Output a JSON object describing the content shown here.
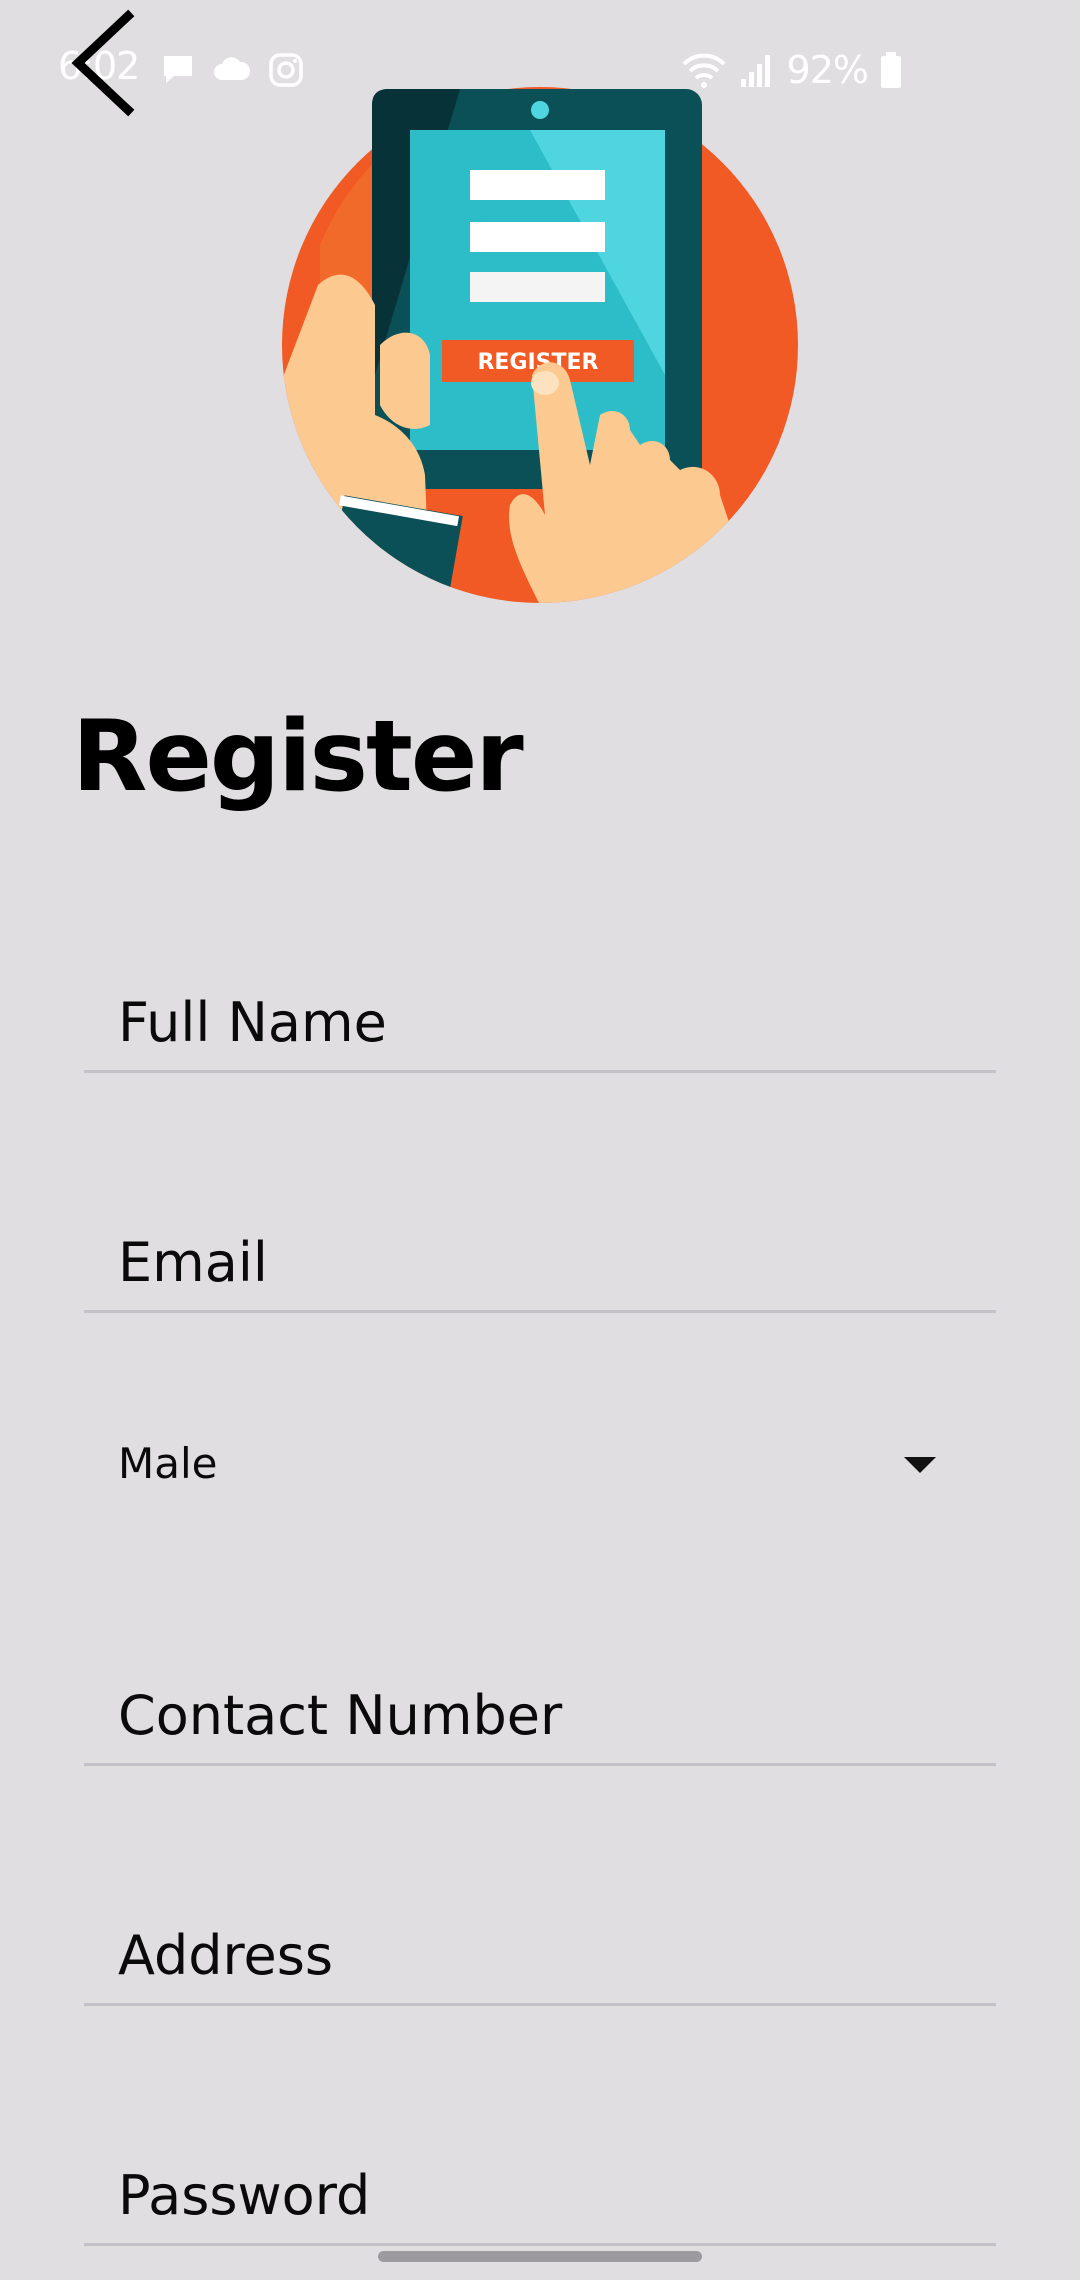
{
  "status_bar": {
    "time": "6:02",
    "battery": "92%",
    "icons_left": [
      "message-icon",
      "cloud-icon",
      "instagram-icon"
    ],
    "icons_right": [
      "wifi-icon",
      "signal-icon",
      "battery-icon"
    ]
  },
  "illustration": {
    "button_text": "REGISTER"
  },
  "page": {
    "title": "Register"
  },
  "form": {
    "full_name_placeholder": "Full Name",
    "email_placeholder": "Email",
    "gender_selected": "Male",
    "contact_placeholder": "Contact Number",
    "address_placeholder": "Address",
    "password_placeholder": "Password"
  },
  "colors": {
    "background": "#e0dee0",
    "accent_orange": "#f15a24",
    "tablet_dark": "#0b4f57",
    "screen_teal": "#3cc7d1"
  }
}
